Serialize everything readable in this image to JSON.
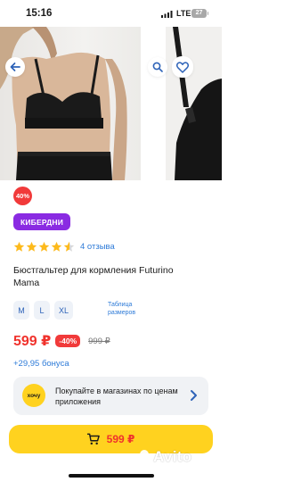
{
  "status_bar": {
    "time": "15:16",
    "network": "LTE",
    "battery": "27"
  },
  "gallery": {
    "images": [
      "model-wearing-black-nursing-bra",
      "black-nursing-bra-closeup"
    ]
  },
  "badge": {
    "discount": "40%"
  },
  "promo": {
    "label": "КИБЕРДНИ"
  },
  "rating": {
    "stars": 4.5,
    "max": 5,
    "reviews_label": "4 отзыва"
  },
  "product": {
    "title": "Бюстгальтер для кормления Futurino Mama"
  },
  "sizes": {
    "options": [
      "M",
      "L",
      "XL"
    ],
    "table_link": "Таблица размеров"
  },
  "price": {
    "current": "599 ₽",
    "discount": "-40%",
    "old": "999 ₽"
  },
  "bonus": {
    "label": "+29,95 бонуса"
  },
  "app_banner": {
    "icon_text": "хочу",
    "text": "Покупайте в магазинах по ценам приложения"
  },
  "buy": {
    "price": "599 ₽"
  },
  "watermark": {
    "text": "Avito"
  },
  "colors": {
    "accent_red": "#f0322c",
    "promo_purple": "#8a2be2",
    "link_blue": "#2e7bd8",
    "cta_yellow": "#ffd21f"
  }
}
